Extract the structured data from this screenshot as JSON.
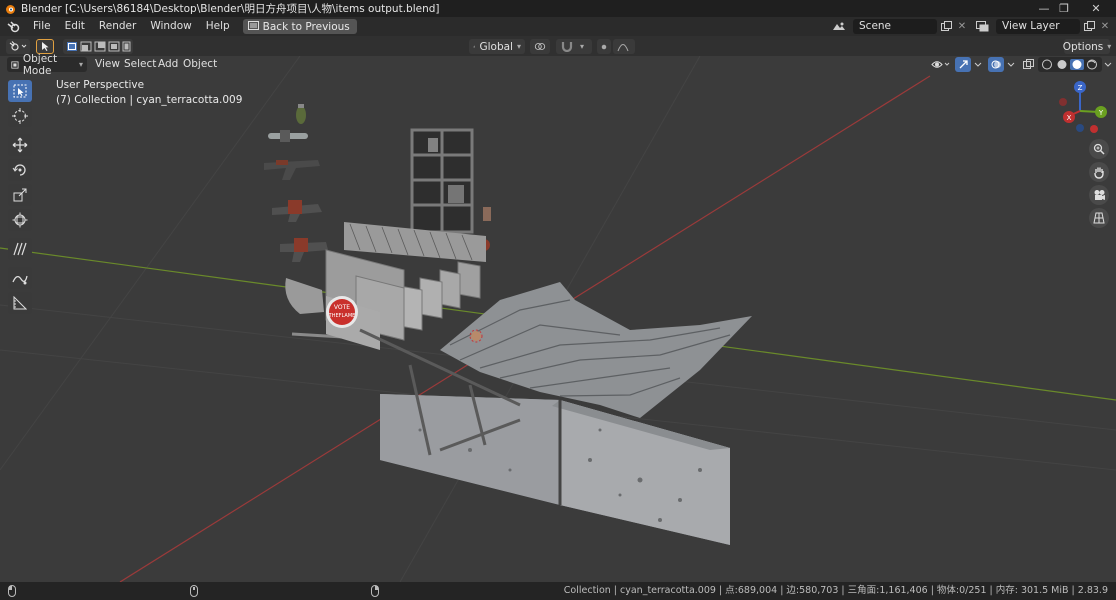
{
  "window": {
    "title": "Blender [C:\\Users\\86184\\Desktop\\Blender\\明日方舟项目\\人物\\items output.blend]",
    "controls": [
      "—",
      "❐",
      "✕"
    ]
  },
  "menubar": {
    "items": [
      "File",
      "Edit",
      "Render",
      "Window",
      "Help"
    ],
    "back_label": "Back to Previous",
    "scene": "Scene",
    "view_layer": "View Layer"
  },
  "toolbar": {
    "orientation": "Global",
    "options_label": "Options"
  },
  "viewport_header": {
    "mode": "Object Mode",
    "menus": [
      "View",
      "Select",
      "Add",
      "Object"
    ]
  },
  "viewport": {
    "perspective_label": "User Perspective",
    "collection_label": "(7) Collection | cyan_terracotta.009",
    "sign_text_1": "VOTE",
    "sign_text_2": "THEFLAME",
    "gizmo": {
      "z": "Z",
      "y": "Y",
      "x": "X"
    }
  },
  "left_tools": [
    "select-box",
    "cursor",
    "move",
    "rotate",
    "scale",
    "transform",
    "annotate",
    "annotate-line",
    "measure"
  ],
  "status": {
    "text": "Collection | cyan_terracotta.009 | 点:689,004 | 边:580,703 | 三角面:1,161,406 | 物体:0/251 | 内存: 301.5 MiB | 2.83.9"
  },
  "colors": {
    "accent": "#4772b3",
    "grid_x_axis": "#9a3a3a",
    "grid_y_axis": "#6a8a2a",
    "background": "#3d3d3d"
  }
}
